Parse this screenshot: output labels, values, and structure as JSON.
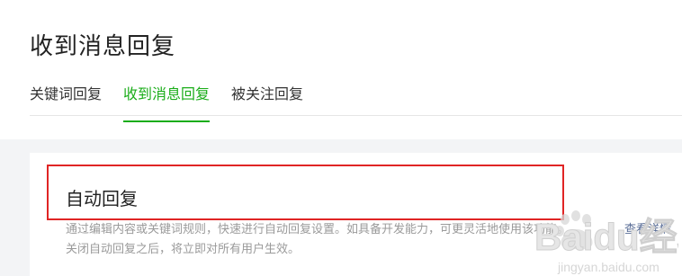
{
  "page": {
    "title": "收到消息回复"
  },
  "tabs": [
    {
      "label": "关键词回复",
      "active": false
    },
    {
      "label": "收到消息回复",
      "active": true
    },
    {
      "label": "被关注回复",
      "active": false
    }
  ],
  "card": {
    "title": "自动回复",
    "description_line1": "通过编辑内容或关键词规则，快速进行自动回复设置。如具备开发能力，可更灵活地使用该功能。",
    "description_line2": "关闭自动回复之后，将立即对所有用户生效。",
    "detail_link": "查看详情"
  },
  "watermark": {
    "brand": "Baidu经验",
    "url": "jingyan.baidu.com"
  },
  "colors": {
    "accent_green": "#1aad19",
    "highlight_red": "#e02525",
    "link_blue": "#576b95"
  }
}
